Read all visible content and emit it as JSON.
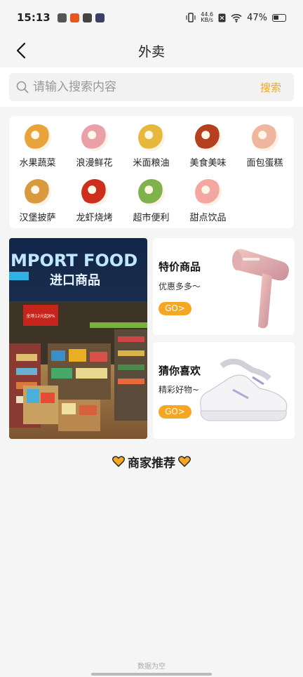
{
  "status_bar": {
    "time": "15:13",
    "net_speed_value": "44.6",
    "net_speed_unit": "KB/s",
    "battery": "47%",
    "icons": [
      "mail-icon",
      "app-icon",
      "link-icon",
      "play-icon",
      "vibrate-icon",
      "sim-off-icon",
      "wifi-icon",
      "battery-icon"
    ]
  },
  "nav": {
    "title": "外卖",
    "back_icon": "chevron-left-icon"
  },
  "search": {
    "placeholder": "请输入搜索内容",
    "button_label": "搜索",
    "icon": "search-icon"
  },
  "categories": [
    {
      "label": "水果蔬菜",
      "icon": "fruit-icon",
      "color": "#e8a33a"
    },
    {
      "label": "浪漫鲜花",
      "icon": "flower-icon",
      "color": "#e9a0a8"
    },
    {
      "label": "米面粮油",
      "icon": "oil-icon",
      "color": "#e6b93c"
    },
    {
      "label": "美食美味",
      "icon": "food-icon",
      "color": "#b5401f"
    },
    {
      "label": "面包蛋糕",
      "icon": "cake-icon",
      "color": "#f0b7a0"
    },
    {
      "label": "汉堡披萨",
      "icon": "burger-icon",
      "color": "#d99a3e"
    },
    {
      "label": "龙虾烧烤",
      "icon": "crayfish-icon",
      "color": "#cc2f1c"
    },
    {
      "label": "超市便利",
      "icon": "grocery-icon",
      "color": "#7fb24a"
    },
    {
      "label": "甜点饮品",
      "icon": "drink-icon",
      "color": "#f4a6a0"
    }
  ],
  "promo_left": {
    "sign_top": "MPORT FOOD",
    "sign_cn": "进口商品",
    "price_sign": "全场12元起8%"
  },
  "promo_cards": [
    {
      "title": "特价商品",
      "subtitle": "优惠多多～",
      "button": "GO>",
      "image": "hair-dryer"
    },
    {
      "title": "猜你喜欢",
      "subtitle": "精彩好物~",
      "button": "GO>",
      "image": "sneaker"
    }
  ],
  "merchant": {
    "title": "商家推荐",
    "icon": "heart-icon"
  },
  "empty_text": "数据为空",
  "colors": {
    "accent": "#f5a623",
    "background": "#f5f5f5",
    "card": "#ffffff"
  }
}
